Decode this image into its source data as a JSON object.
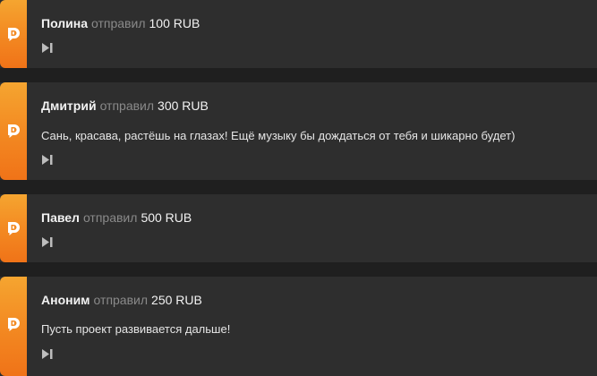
{
  "verb_label": "отправил",
  "icons": {
    "brand": "donationalerts-logo-icon",
    "play": "play-next-icon"
  },
  "colors": {
    "accent_top": "#f5a530",
    "accent_bottom": "#f07318",
    "card_bg": "#2e2e2e",
    "page_bg": "#1f1f1f"
  },
  "donations": [
    {
      "name": "Полина",
      "amount": "100 RUB",
      "message": ""
    },
    {
      "name": "Дмитрий",
      "amount": "300 RUB",
      "message": "Сань, красава, растёшь на глазах! Ещё музыку бы дождаться от тебя и шикарно будет)"
    },
    {
      "name": "Павел",
      "amount": "500 RUB",
      "message": ""
    },
    {
      "name": "Аноним",
      "amount": "250 RUB",
      "message": "Пусть проект развивается дальше!"
    }
  ]
}
